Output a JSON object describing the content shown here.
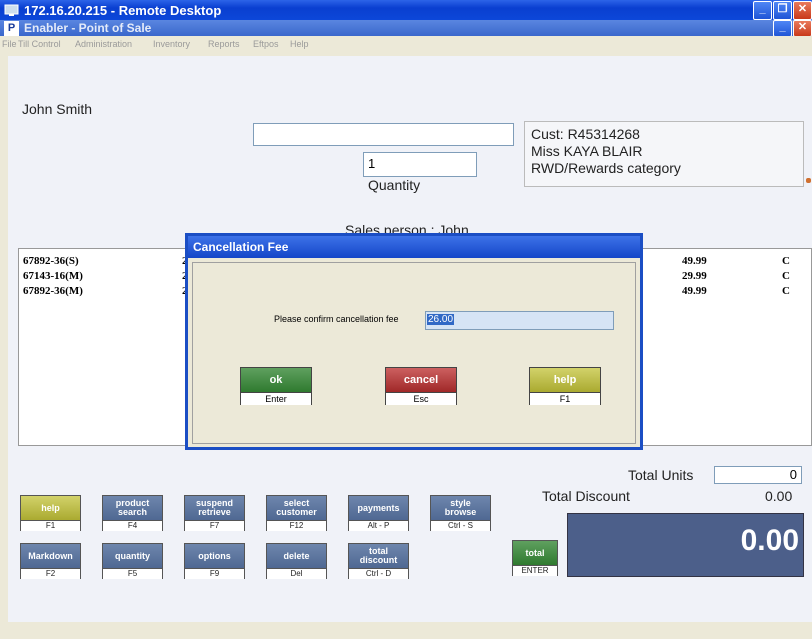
{
  "outer_window": {
    "title": "172.16.20.215 - Remote Desktop"
  },
  "app_window": {
    "title": "Enabler - Point of Sale"
  },
  "menu": [
    "File",
    "Till Control",
    "Administration",
    "Inventory",
    "Reports",
    "Eftpos",
    "Help"
  ],
  "operator": "John Smith",
  "product_input": {
    "value": ""
  },
  "quantity": {
    "value": "1",
    "label": "Quantity"
  },
  "customer": {
    "line1": "Cust: R45314268",
    "line2": "Miss KAYA BLAIR",
    "line3": "RWD/Rewards category"
  },
  "sales_person": "Sales person : John",
  "items": [
    {
      "code": "67892-36(S)",
      "qty": "2",
      "price": "49.99",
      "flag": "C"
    },
    {
      "code": "67143-16(M)",
      "qty": "2",
      "price": "29.99",
      "flag": "C"
    },
    {
      "code": "67892-36(M)",
      "qty": "2",
      "price": "49.99",
      "flag": "C"
    }
  ],
  "dialog": {
    "title": "Cancellation Fee",
    "prompt": "Please confirm cancellation fee",
    "value": "26.00",
    "ok": {
      "label": "ok",
      "key": "Enter"
    },
    "cancel": {
      "label": "cancel",
      "key": "Esc"
    },
    "help": {
      "label": "help",
      "key": "F1"
    }
  },
  "totals": {
    "units_label": "Total Units",
    "units_value": "0",
    "discount_label": "Total Discount",
    "discount_value": "0.00",
    "grand_total": "0.00"
  },
  "keys": {
    "help": {
      "l1": "help",
      "l2": "",
      "key": "F1"
    },
    "product_search": {
      "l1": "product",
      "l2": "search",
      "key": "F4"
    },
    "suspend": {
      "l1": "suspend",
      "l2": "retrieve",
      "key": "F7"
    },
    "select_customer": {
      "l1": "select",
      "l2": "customer",
      "key": "F12"
    },
    "payments": {
      "l1": "payments",
      "l2": "",
      "key": "Alt - P"
    },
    "style_browse": {
      "l1": "style",
      "l2": "browse",
      "key": "Ctrl - S"
    },
    "markdown": {
      "l1": "Markdown",
      "l2": "",
      "key": "F2"
    },
    "quantity": {
      "l1": "quantity",
      "l2": "",
      "key": "F5"
    },
    "options": {
      "l1": "options",
      "l2": "",
      "key": "F9"
    },
    "delete": {
      "l1": "delete",
      "l2": "",
      "key": "Del"
    },
    "total_discount": {
      "l1": "total",
      "l2": "discount",
      "key": "Ctrl - D"
    },
    "total": {
      "l1": "total",
      "l2": "",
      "key": "ENTER"
    }
  },
  "colors": {
    "titlebar": "#0a3fd0",
    "total_panel": "#4c5f8a",
    "dialog_field": "#d6e4f5",
    "accent_selection": "#3169c6"
  }
}
